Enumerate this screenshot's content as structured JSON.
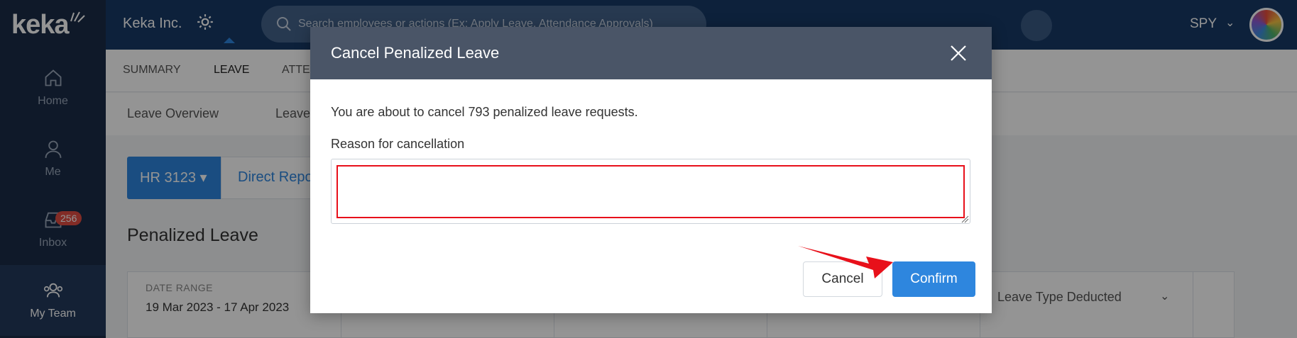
{
  "app": {
    "brand": "keka",
    "company": "Keka Inc.",
    "search_placeholder": "Search employees or actions (Ex: Apply Leave, Attendance Approvals)",
    "user_code": "SPY"
  },
  "sidebar": {
    "items": [
      {
        "label": "Home",
        "icon": "home-icon"
      },
      {
        "label": "Me",
        "icon": "person-icon"
      },
      {
        "label": "Inbox",
        "icon": "inbox-icon",
        "badge": "256"
      },
      {
        "label": "My Team",
        "icon": "team-icon"
      }
    ]
  },
  "tabs": [
    {
      "label": "SUMMARY"
    },
    {
      "label": "LEAVE"
    },
    {
      "label": "ATTE"
    }
  ],
  "subtabs": [
    {
      "label": "Leave Overview"
    },
    {
      "label": "Leave"
    }
  ],
  "scope": {
    "hr_label": "HR 3123",
    "direct_label": "Direct Repo"
  },
  "page": {
    "title": "Penalized Leave",
    "date_range_label": "DATE RANGE",
    "date_range_value": "19 Mar 2023 - 17 Apr 2023",
    "leave_type_label": "Leave Type Deducted"
  },
  "modal": {
    "title": "Cancel Penalized Leave",
    "message": "You are about to cancel 793 penalized leave requests.",
    "reason_label": "Reason for cancellation",
    "reason_value": "",
    "cancel_label": "Cancel",
    "confirm_label": "Confirm"
  },
  "colors": {
    "accent": "#2e86de",
    "header": "#173a66",
    "sidebar": "#1b2c47",
    "modal_header": "#4a5567",
    "annotation_red": "#e8101a"
  }
}
